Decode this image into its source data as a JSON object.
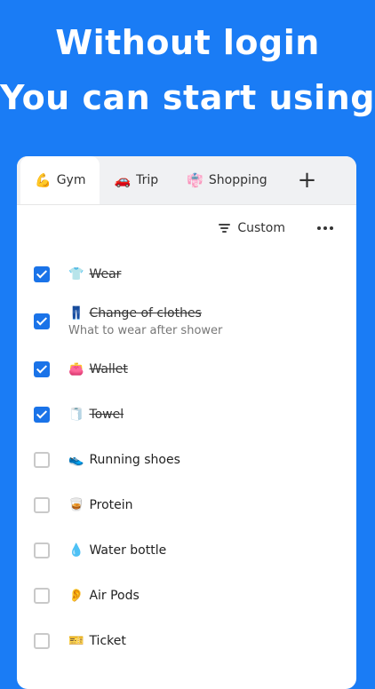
{
  "headline": {
    "line1": "Without login",
    "line2": "You can start using"
  },
  "tabs": [
    {
      "icon": "💪",
      "label": "Gym",
      "active": true
    },
    {
      "icon": "🚗",
      "label": "Trip",
      "active": false
    },
    {
      "icon": "👘",
      "label": "Shopping",
      "active": false
    }
  ],
  "add_tab_label": "+",
  "toolbar": {
    "sort_label": "Custom"
  },
  "items": [
    {
      "icon": "👕",
      "label": "Wear",
      "note": "",
      "checked": true
    },
    {
      "icon": "👖",
      "label": "Change of clothes",
      "note": "What to wear after shower",
      "checked": true
    },
    {
      "icon": "👛",
      "label": "Wallet",
      "note": "",
      "checked": true
    },
    {
      "icon": "🧻",
      "label": "Towel",
      "note": "",
      "checked": true
    },
    {
      "icon": "👟",
      "label": "Running shoes",
      "note": "",
      "checked": false
    },
    {
      "icon": "🥃",
      "label": "Protein",
      "note": "",
      "checked": false
    },
    {
      "icon": "💧",
      "label": "Water bottle",
      "note": "",
      "checked": false
    },
    {
      "icon": "👂",
      "label": "Air Pods",
      "note": "",
      "checked": false
    },
    {
      "icon": "🎫",
      "label": "Ticket",
      "note": "",
      "checked": false
    }
  ],
  "colors": {
    "background": "#1a7cf5",
    "checkbox_checked": "#1a73e8"
  }
}
